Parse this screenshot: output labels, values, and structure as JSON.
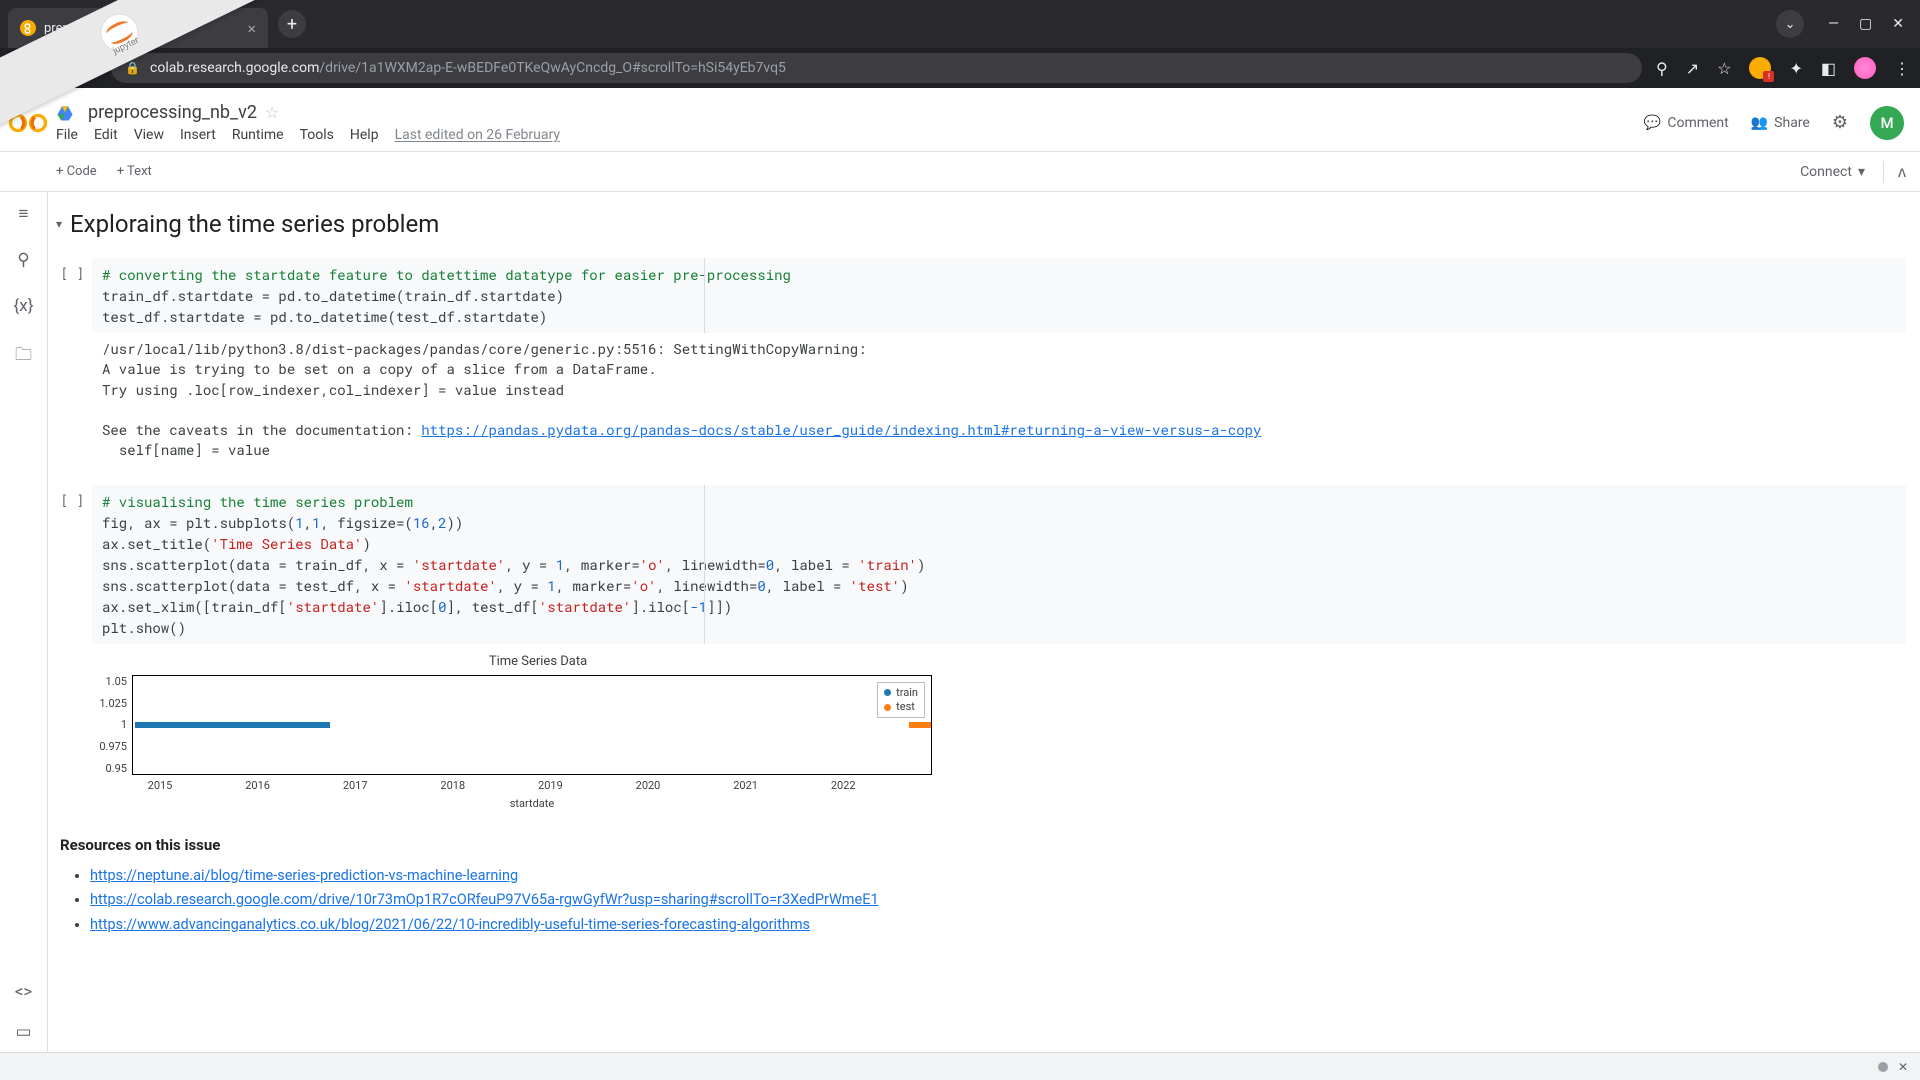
{
  "browser": {
    "tab_title": "prep…v2 - C",
    "url_host": "colab.research.google.com",
    "url_path": "/drive/1a1WXM2ap-E-wBEDFe0TKeQwAyCncdg_O#scrollTo=hSi54yEb7vq5"
  },
  "colab": {
    "doc_title": "preprocessing_nb_v2",
    "menus": [
      "File",
      "Edit",
      "View",
      "Insert",
      "Runtime",
      "Tools",
      "Help"
    ],
    "last_edit": "Last edited on 26 February",
    "comment": "Comment",
    "share": "Share",
    "avatar_initial": "M",
    "add_code": "+ Code",
    "add_text": "+ Text",
    "connect": "Connect"
  },
  "section_title": "Exploraing the time series problem",
  "cell1": {
    "prompt": "[ ]",
    "line1_comment": "# converting the startdate feature to datettime datatype for easier pre-processing",
    "line2": "train_df.startdate = pd.to_datetime(train_df.startdate)",
    "line3": "test_df.startdate = pd.to_datetime(test_df.startdate)",
    "output_lines": [
      "/usr/local/lib/python3.8/dist-packages/pandas/core/generic.py:5516: SettingWithCopyWarning: ",
      "A value is trying to be set on a copy of a slice from a DataFrame.",
      "Try using .loc[row_indexer,col_indexer] = value instead",
      "",
      "See the caveats in the documentation: "
    ],
    "output_link": "https://pandas.pydata.org/pandas-docs/stable/user_guide/indexing.html#returning-a-view-versus-a-copy",
    "output_tail": "  self[name] = value"
  },
  "cell2": {
    "prompt": "[ ]",
    "line1_comment": "# visualising the time series problem",
    "l2a": "fig, ax = plt.subplots(",
    "l2b": "1",
    "l2c": ",",
    "l2d": "1",
    "l2e": ", figsize=(",
    "l2f": "16",
    "l2g": ",",
    "l2h": "2",
    "l2i": "))",
    "l3a": "ax.set_title(",
    "l3b": "'Time Series Data'",
    "l3c": ")",
    "l4a": "sns.scatterplot(data = train_df, x = ",
    "l4b": "'startdate'",
    "l4c": ", y = ",
    "l4d": "1",
    "l4e": ", marker=",
    "l4f": "'o'",
    "l4g": ", linewidth=",
    "l4h": "0",
    "l4i": ", label = ",
    "l4j": "'train'",
    "l4k": ")",
    "l5a": "sns.scatterplot(data = test_df, x = ",
    "l5b": "'startdate'",
    "l5c": ", y = ",
    "l5d": "1",
    "l5e": ", marker=",
    "l5f": "'o'",
    "l5g": ", linewidth=",
    "l5h": "0",
    "l5i": ", label = ",
    "l5j": "'test'",
    "l5k": ")",
    "l6a": "ax.set_xlim([train_df[",
    "l6b": "'startdate'",
    "l6c": "].iloc[",
    "l6d": "0",
    "l6e": "], test_df[",
    "l6f": "'startdate'",
    "l6g": "].iloc[",
    "l6h": "-1",
    "l6i": "]])",
    "l7": "plt.show()"
  },
  "chart_data": {
    "type": "scatter",
    "title": "Time Series Data",
    "xlabel": "startdate",
    "ylabel": "",
    "ylim": [
      0.95,
      1.05
    ],
    "yticks": [
      1.05,
      1.025,
      1.0,
      0.975,
      0.95
    ],
    "xticks": [
      "2015",
      "2016",
      "2017",
      "2018",
      "2019",
      "2020",
      "2021",
      "2022"
    ],
    "legend": [
      "train",
      "test"
    ],
    "legend_colors": {
      "train": "#1f77b4",
      "test": "#ff7f0e"
    },
    "series": [
      {
        "name": "train",
        "y": 1.0,
        "x_range_approx": [
          "2014-09",
          "2016-11"
        ]
      },
      {
        "name": "test",
        "y": 1.0,
        "x_range_approx": [
          "2022-07",
          "2022-10"
        ]
      }
    ]
  },
  "resources": {
    "heading": "Resources on this issue",
    "links": [
      "https://neptune.ai/blog/time-series-prediction-vs-machine-learning",
      "https://colab.research.google.com/drive/10r73mOp1R7cORfeuP97V65a-rgwGyfWr?usp=sharing#scrollTo=r3XedPrWmeE1",
      "https://www.advancinganalytics.co.uk/blog/2021/06/22/10-incredibly-useful-time-series-forecasting-algorithms"
    ]
  }
}
